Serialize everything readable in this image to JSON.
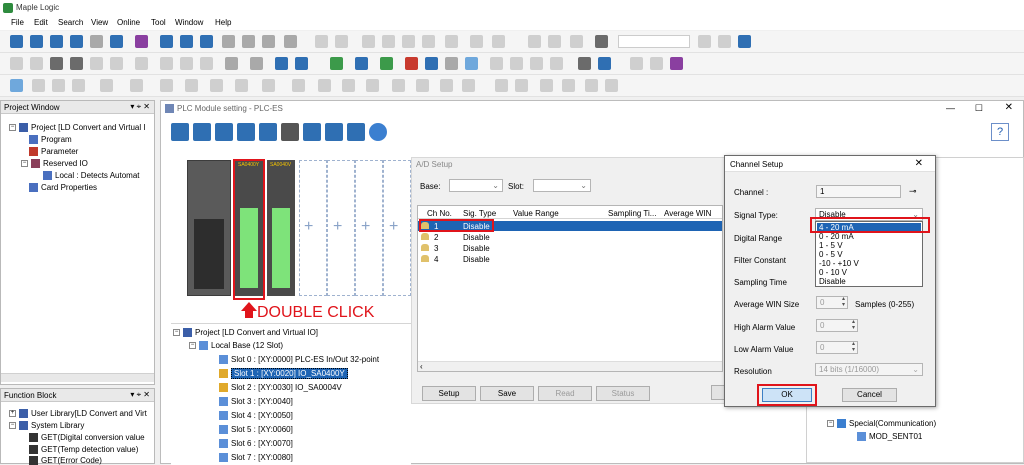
{
  "app": {
    "title": "Maple Logic"
  },
  "menu": [
    "File",
    "Edit",
    "Search",
    "View",
    "Online",
    "Tool",
    "Window",
    "Help"
  ],
  "project_window": {
    "title": "Project Window",
    "tree": [
      {
        "label": "Project [LD Convert and Virtual I"
      },
      {
        "label": "Program"
      },
      {
        "label": "Parameter"
      },
      {
        "label": "Reserved IO"
      },
      {
        "label": "Local : Detects Automat"
      },
      {
        "label": "Card Properties"
      }
    ]
  },
  "function_block": {
    "title": "Function Block",
    "tree": [
      {
        "label": "User Library[LD Convert and Virt"
      },
      {
        "label": "System Library"
      },
      {
        "label": "GET(Digital conversion value"
      },
      {
        "label": "GET(Temp detection value)"
      },
      {
        "label": "GET(Error Code)"
      }
    ]
  },
  "plc_window": {
    "title": "PLC Module setting - PLC-ES",
    "help": "?",
    "module_label_1": "SA0400Y",
    "module_label_2": "SA0040V",
    "annotation": "DOUBLE CLICK",
    "io_tree": [
      {
        "label": "Project [LD Convert and Virtual IO]"
      },
      {
        "label": "Local Base (12 Slot)"
      },
      {
        "label": "Slot 0 : [XY:0000] PLC-ES In/Out 32-point"
      },
      {
        "label": "Slot 1 : [XY:0020] IO_SA0400Y"
      },
      {
        "label": "Slot 2 : [XY:0030] IO_SA0004V"
      },
      {
        "label": "Slot 3 : [XY:0040]"
      },
      {
        "label": "Slot 4 : [XY:0050]"
      },
      {
        "label": "Slot 5 : [XY:0060]"
      },
      {
        "label": "Slot 6 : [XY:0070]"
      },
      {
        "label": "Slot 7 : [XY:0080]"
      }
    ],
    "ad_setup": {
      "title": "A/D Setup",
      "base_label": "Base:",
      "slot_label": "Slot:",
      "columns": [
        "Ch No.",
        "Sig. Type",
        "Value Range",
        "Sampling Ti...",
        "Average WIN"
      ],
      "rows": [
        {
          "ch": "1",
          "sig": "Disable"
        },
        {
          "ch": "2",
          "sig": "Disable"
        },
        {
          "ch": "3",
          "sig": "Disable"
        },
        {
          "ch": "4",
          "sig": "Disable"
        }
      ],
      "buttons": [
        "Setup",
        "Save",
        "Read",
        "Status"
      ]
    },
    "right_tree": [
      {
        "label": "Special(Communication)"
      },
      {
        "label": "MOD_SENT01"
      }
    ]
  },
  "channel_setup": {
    "title": "Channel Setup",
    "close": "✕",
    "channel_label": "Channel :",
    "channel_value": "1",
    "signal_type_label": "Signal Type:",
    "signal_type_value": "Disable",
    "signal_options": [
      "4 - 20 mA",
      "0 - 20 mA",
      "1 - 5 V",
      "0 - 5 V",
      "-10 - +10 V",
      "0 - 10 V",
      "Disable"
    ],
    "digital_range_label": "Digital Range",
    "filter_constant_label": "Filter Constant",
    "sampling_time_label": "Sampling Time",
    "average_win_label": "Average WIN Size",
    "average_win_value": "0",
    "average_win_suffix": "Samples (0-255)",
    "high_alarm_label": "High Alarm Value",
    "high_alarm_value": "0",
    "low_alarm_label": "Low Alarm Value",
    "low_alarm_value": "0",
    "resolution_label": "Resolution",
    "resolution_value": "14 bits (1/16000)",
    "ok": "OK",
    "cancel": "Cancel"
  },
  "colors": {
    "highlight": "#e0141b",
    "selection": "#1e64b4",
    "module_green": "#7ee37a",
    "module_dark": "#3a3a3a"
  }
}
